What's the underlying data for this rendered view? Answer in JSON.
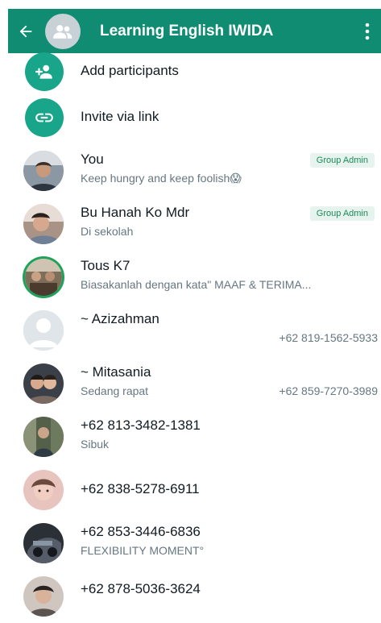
{
  "header": {
    "title": "Learning English IWIDA",
    "back_icon": "arrow-left-icon",
    "menu_icon": "kebab-menu-icon"
  },
  "actions": [
    {
      "label": "Add participants",
      "icon": "add-person-icon"
    },
    {
      "label": "Invite via link",
      "icon": "link-icon"
    }
  ],
  "participants": [
    {
      "name": "You",
      "about": "Keep hungry and keep foolish😱",
      "badge": "Group Admin",
      "phone": ""
    },
    {
      "name": "Bu Hanah Ko Mdr",
      "about": "Di sekolah",
      "badge": "Group Admin",
      "phone": ""
    },
    {
      "name": "Tous K7",
      "about": "Biasakanlah dengan kata\" MAAF & TERIMA...",
      "badge": "",
      "phone": ""
    },
    {
      "name": "~ Azizahman",
      "about": "",
      "badge": "",
      "phone": "+62 819-1562-5933"
    },
    {
      "name": "~ Mitasania",
      "about": "Sedang rapat",
      "badge": "",
      "phone": "+62 859-7270-3989"
    },
    {
      "name": "+62 813-3482-1381",
      "about": "Sibuk",
      "badge": "",
      "phone": ""
    },
    {
      "name": "+62 838-5278-6911",
      "about": "",
      "badge": "",
      "phone": ""
    },
    {
      "name": "+62 853-3446-6836",
      "about": "FLEXIBILITY MOMENT°",
      "badge": "",
      "phone": ""
    },
    {
      "name": "+62 878-5036-3624",
      "about": "",
      "badge": "",
      "phone": ""
    }
  ],
  "colors": {
    "header": "#0f8c72",
    "action_icon": "#18a589",
    "badge_bg": "#e7f3ee",
    "badge_text": "#1b8a5a"
  }
}
